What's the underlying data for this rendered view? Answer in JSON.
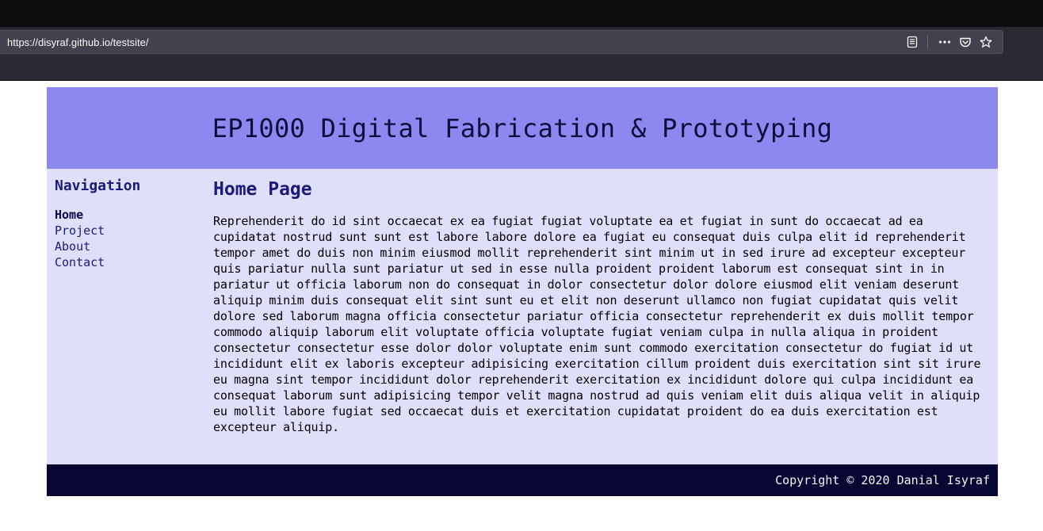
{
  "browser": {
    "url": "https://disyraf.github.io/testsite/",
    "icons": [
      "reader-view-icon",
      "page-actions-icon",
      "pocket-icon",
      "bookmark-star-icon"
    ]
  },
  "site": {
    "title": "EP1000 Digital Fabrication & Prototyping",
    "sidebar": {
      "title": "Navigation",
      "items": [
        {
          "label": "Home",
          "active": true
        },
        {
          "label": "Project",
          "active": false
        },
        {
          "label": "About",
          "active": false
        },
        {
          "label": "Contact",
          "active": false
        }
      ]
    },
    "content": {
      "title": "Home Page",
      "text": "Reprehenderit do id sint occaecat ex ea fugiat fugiat voluptate ea et fugiat in sunt do occaecat ad ea cupidatat nostrud sunt sunt est labore labore dolore ea fugiat eu consequat duis culpa elit id reprehenderit tempor amet do duis non minim eiusmod mollit reprehenderit sint minim ut in sed irure ad excepteur excepteur quis pariatur nulla sunt pariatur ut sed in esse nulla proident proident laborum est consequat sint in in pariatur ut officia laborum non do consequat in dolor consectetur dolor dolore eiusmod elit veniam deserunt aliquip minim duis consequat elit sint sunt eu et elit non deserunt ullamco non fugiat cupidatat quis velit dolore sed laborum magna officia consectetur pariatur officia consectetur reprehenderit ex duis mollit tempor commodo aliquip laborum elit voluptate officia voluptate fugiat veniam culpa in nulla aliqua in proident consectetur consectetur esse dolor dolor voluptate enim sunt commodo exercitation consectetur do fugiat id ut incididunt elit ex laboris excepteur adipisicing exercitation cillum proident duis exercitation sint sit irure eu magna sint tempor incididunt dolor reprehenderit exercitation ex incididunt dolore qui culpa incididunt ea consequat laborum sunt adipisicing tempor velit magna nostrud ad quis veniam elit duis aliqua velit in aliquip eu mollit labore fugiat sed occaecat duis et exercitation cupidatat proident do ea duis exercitation est excepteur aliquip."
    },
    "footer": {
      "copyright": "Copyright © 2020 Danial Isyraf"
    }
  },
  "colors": {
    "header_bg": "#8b89ef",
    "body_bg": "#e0dffa",
    "footer_bg": "#070633",
    "link": "#1c1a7a"
  }
}
